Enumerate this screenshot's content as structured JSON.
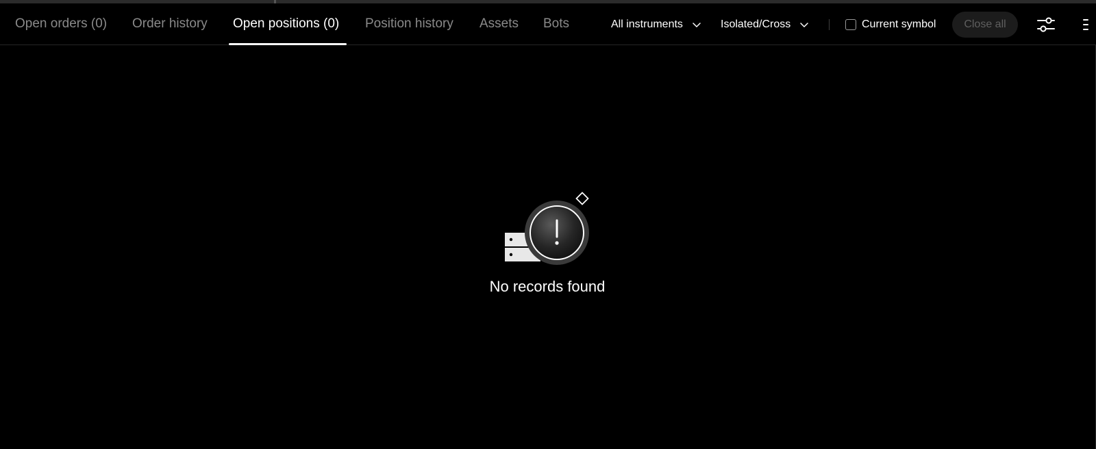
{
  "tabs": [
    {
      "label": "Open orders (0)",
      "active": false
    },
    {
      "label": "Order history",
      "active": false
    },
    {
      "label": "Open positions (0)",
      "active": true
    },
    {
      "label": "Position history",
      "active": false
    },
    {
      "label": "Assets",
      "active": false
    },
    {
      "label": "Bots",
      "active": false
    }
  ],
  "filters": {
    "instruments": {
      "selected": "All instruments",
      "icon": "chevron-down-icon"
    },
    "margin_mode": {
      "selected": "Isolated/Cross",
      "icon": "chevron-down-icon"
    }
  },
  "current_symbol": {
    "label": "Current symbol",
    "checked": false
  },
  "actions": {
    "close_all_label": "Close all",
    "settings_icon": "sliders-icon",
    "more_icon": "more-vertical-icon"
  },
  "empty_state": {
    "message": "No records found",
    "icon": "empty-records-icon"
  },
  "colors": {
    "background": "#000000",
    "active_tab": "#ffffff",
    "inactive_tab": "#8a8a8a",
    "disabled_button_bg": "#1c1c1c",
    "disabled_button_text": "#5f5f5f"
  }
}
